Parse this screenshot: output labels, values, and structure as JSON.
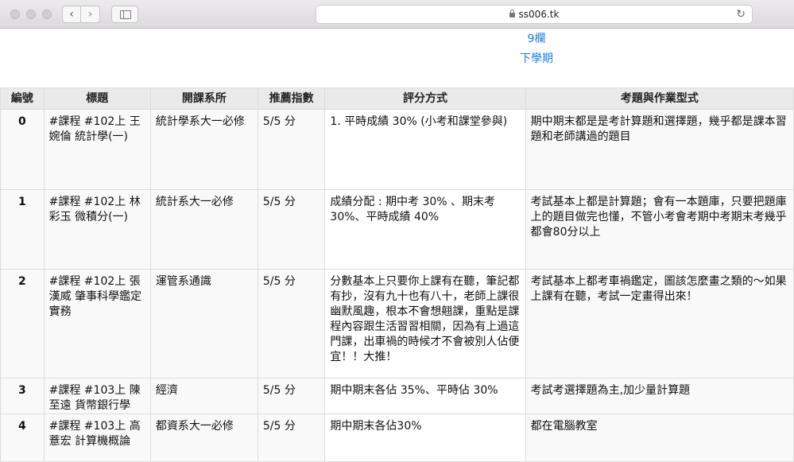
{
  "browser": {
    "url": "ss006.tk",
    "back_glyph": "‹",
    "forward_glyph": "›",
    "reload_glyph": "↻",
    "icons": [
      "close-light",
      "minimize-light",
      "zoom-light",
      "sidebar-icon",
      "lock-icon",
      "reload-icon"
    ]
  },
  "header": {
    "columns_link": "9欄",
    "semester_link": "下學期"
  },
  "colors": {
    "link": "#1a7ee0",
    "header_bg": "#eaeaea",
    "border": "#dcdcdc"
  },
  "table": {
    "headers": [
      "編號",
      "標題",
      "開課系所",
      "推薦指數",
      "評分方式",
      "考題與作業型式"
    ],
    "rows": [
      {
        "id": "0",
        "title": "#課程 #102上 王婉倫 統計學(一)",
        "dept": "統計學系大一必修",
        "rating": "5/5 分",
        "grading": "1. 平時成績 30% (小考和課堂參與)",
        "exam": "期中期末都是是考計算題和選擇題，幾乎都是課本習題和老師講過的題目"
      },
      {
        "id": "1",
        "title": "#課程 #102上 林彩玉 微積分(一)",
        "dept": "統計系大一必修",
        "rating": "5/5 分",
        "grading": "成績分配 : 期中考 30% 、期末考 30%、平時成績 40%",
        "exam": "考試基本上都是計算題；會有一本題庫，只要把題庫上的題目做完也懂，不管小考會考期中考期末考幾乎都會80分以上"
      },
      {
        "id": "2",
        "title": "#課程 #102上 張漢威 肇事科學鑑定實務",
        "dept": "運管系通識",
        "rating": "5/5 分",
        "grading": "分數基本上只要你上課有在聽，筆記都有抄，沒有九十也有八十，老師上課很幽默風趣，根本不會想翹課，重點是課程內容跟生活習習相關，因為有上過這門課，出車禍的時候才不會被別人佔便宜！！大推！",
        "exam": "考試基本上都考車禍鑑定，圖該怎麼畫之類的～如果上課有在聽，考試一定畫得出來！"
      },
      {
        "id": "3",
        "title": "#課程 #103上 陳至遠 貨幣銀行學",
        "dept": "經濟",
        "rating": "5/5 分",
        "grading": "期中期末各佔 35%、平時佔 30%",
        "exam": "考試考選擇題為主,加少量計算題"
      },
      {
        "id": "4",
        "title": "#課程 #103上 高薏宏 計算機概論",
        "dept": "都資系大一必修",
        "rating": "5/5 分",
        "grading": "期中期末各佔30%",
        "exam": "都在電腦教室"
      }
    ]
  }
}
